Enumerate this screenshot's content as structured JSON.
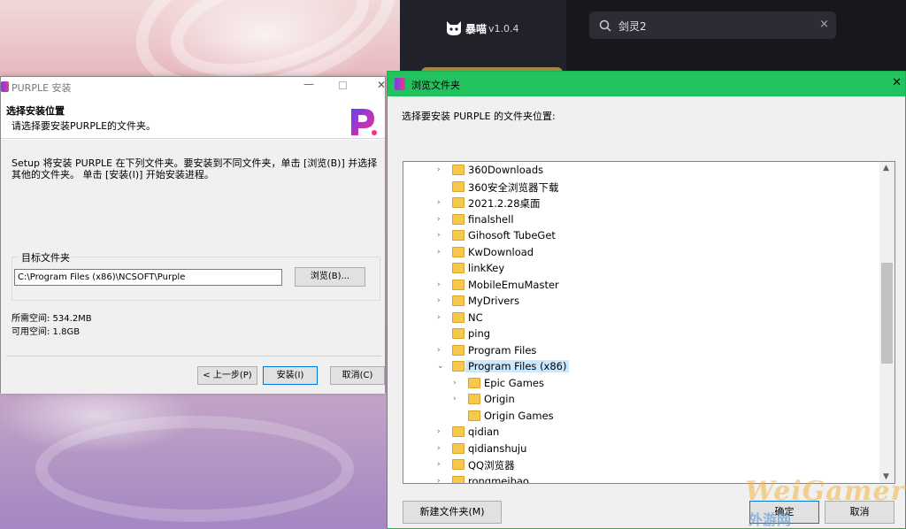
{
  "launcher": {
    "brand": "暴喵",
    "version": "v1.0.4",
    "search_value": "剑灵2",
    "search_clear": "×"
  },
  "installer": {
    "title": "PURPLE 安装",
    "min_glyph": "—",
    "close_glyph": "✕",
    "header_title": "选择安装位置",
    "header_subtitle": "请选择要安装PURPLE的文件夹。",
    "description": "Setup 将安装 PURPLE 在下列文件夹。要安装到不同文件夹，单击 [浏览(B)] 并选择其他的文件夹。 单击 [安装(I)] 开始安装进程。",
    "group_label": "目标文件夹",
    "path_value": "C:\\Program Files (x86)\\NCSOFT\\Purple",
    "browse_label": "浏览(B)...",
    "space_required": "所需空间: 534.2MB",
    "space_available": "可用空间: 1.8GB",
    "back_label": "< 上一步(P)",
    "install_label": "安装(I)",
    "cancel_label": "取消(C)"
  },
  "browse": {
    "title": "浏览文件夹",
    "close_glyph": "✕",
    "prompt": "选择要安装 PURPLE 的文件夹位置:",
    "items": [
      {
        "label": "360Downloads",
        "depth": 0,
        "chevron": "›"
      },
      {
        "label": "360安全浏览器下载",
        "depth": 0,
        "chevron": ""
      },
      {
        "label": "2021.2.28桌面",
        "depth": 0,
        "chevron": "›"
      },
      {
        "label": "finalshell",
        "depth": 0,
        "chevron": "›"
      },
      {
        "label": "Gihosoft TubeGet",
        "depth": 0,
        "chevron": "›"
      },
      {
        "label": "KwDownload",
        "depth": 0,
        "chevron": "›"
      },
      {
        "label": "linkKey",
        "depth": 0,
        "chevron": ""
      },
      {
        "label": "MobileEmuMaster",
        "depth": 0,
        "chevron": "›"
      },
      {
        "label": "MyDrivers",
        "depth": 0,
        "chevron": "›"
      },
      {
        "label": "NC",
        "depth": 0,
        "chevron": "›"
      },
      {
        "label": "ping",
        "depth": 0,
        "chevron": ""
      },
      {
        "label": "Program Files",
        "depth": 0,
        "chevron": "›"
      },
      {
        "label": "Program Files (x86)",
        "depth": 0,
        "chevron": "⌄",
        "selected": true
      },
      {
        "label": "Epic Games",
        "depth": 1,
        "chevron": "›"
      },
      {
        "label": "Origin",
        "depth": 1,
        "chevron": "›"
      },
      {
        "label": "Origin Games",
        "depth": 1,
        "chevron": ""
      },
      {
        "label": "qidian",
        "depth": 0,
        "chevron": "›"
      },
      {
        "label": "qidianshuju",
        "depth": 0,
        "chevron": "›"
      },
      {
        "label": "QQ浏览器",
        "depth": 0,
        "chevron": "›"
      },
      {
        "label": "rongmeibao",
        "depth": 0,
        "chevron": "›"
      }
    ],
    "newfolder_label": "新建文件夹(M)",
    "ok_label": "确定",
    "cancel_label": "取消"
  },
  "watermark": {
    "text": "WeiGamer",
    "sub": "外游网"
  }
}
